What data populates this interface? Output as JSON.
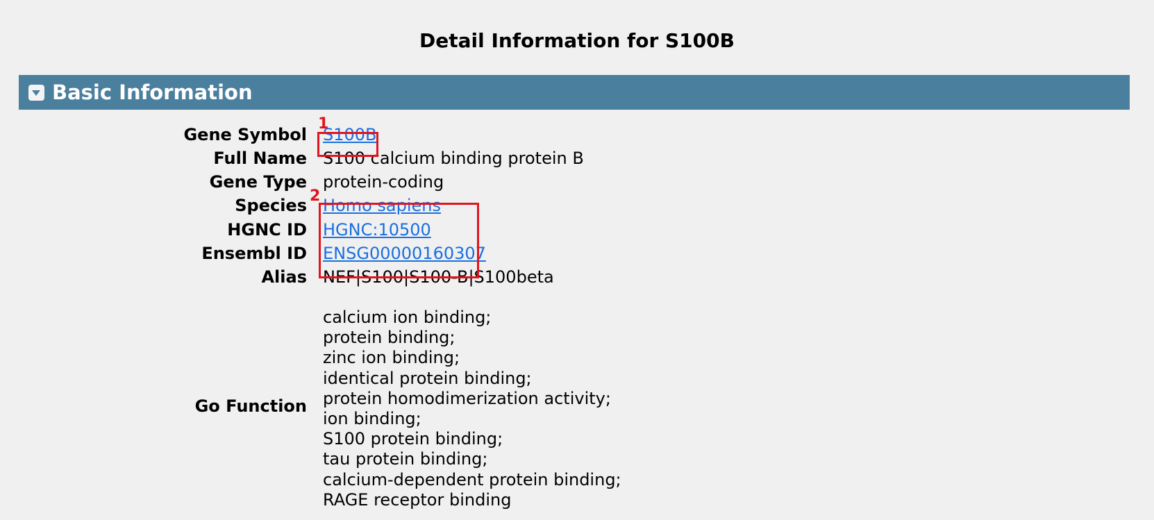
{
  "page": {
    "title": "Detail Information for S100B"
  },
  "section": {
    "title": "Basic Information",
    "toggle_icon": "collapse-toggle-icon"
  },
  "fields": {
    "gene_symbol": {
      "label": "Gene Symbol",
      "value": "S100B"
    },
    "full_name": {
      "label": "Full Name",
      "value": "S100 calcium binding protein B"
    },
    "gene_type": {
      "label": "Gene Type",
      "value": "protein-coding"
    },
    "species": {
      "label": "Species",
      "value": "Homo sapiens"
    },
    "hgnc_id": {
      "label": "HGNC ID",
      "value": "HGNC:10500"
    },
    "ensembl_id": {
      "label": "Ensembl ID",
      "value": "ENSG00000160307"
    },
    "alias": {
      "label": "Alias",
      "value": "NEF|S100|S100-B|S100beta"
    },
    "go_function": {
      "label": "Go Function",
      "values": [
        "calcium ion binding;",
        "protein binding;",
        "zinc ion binding;",
        "identical protein binding;",
        "protein homodimerization activity;",
        "ion binding;",
        "S100 protein binding;",
        "tau protein binding;",
        "calcium-dependent protein binding;",
        "RAGE receptor binding"
      ]
    }
  },
  "annotations": {
    "mark1": "1",
    "mark2": "2",
    "color": "#e0141e"
  },
  "colors": {
    "header_bg": "#4a7f9e",
    "link": "#1a6fe0",
    "page_bg": "#f0f0f0"
  }
}
